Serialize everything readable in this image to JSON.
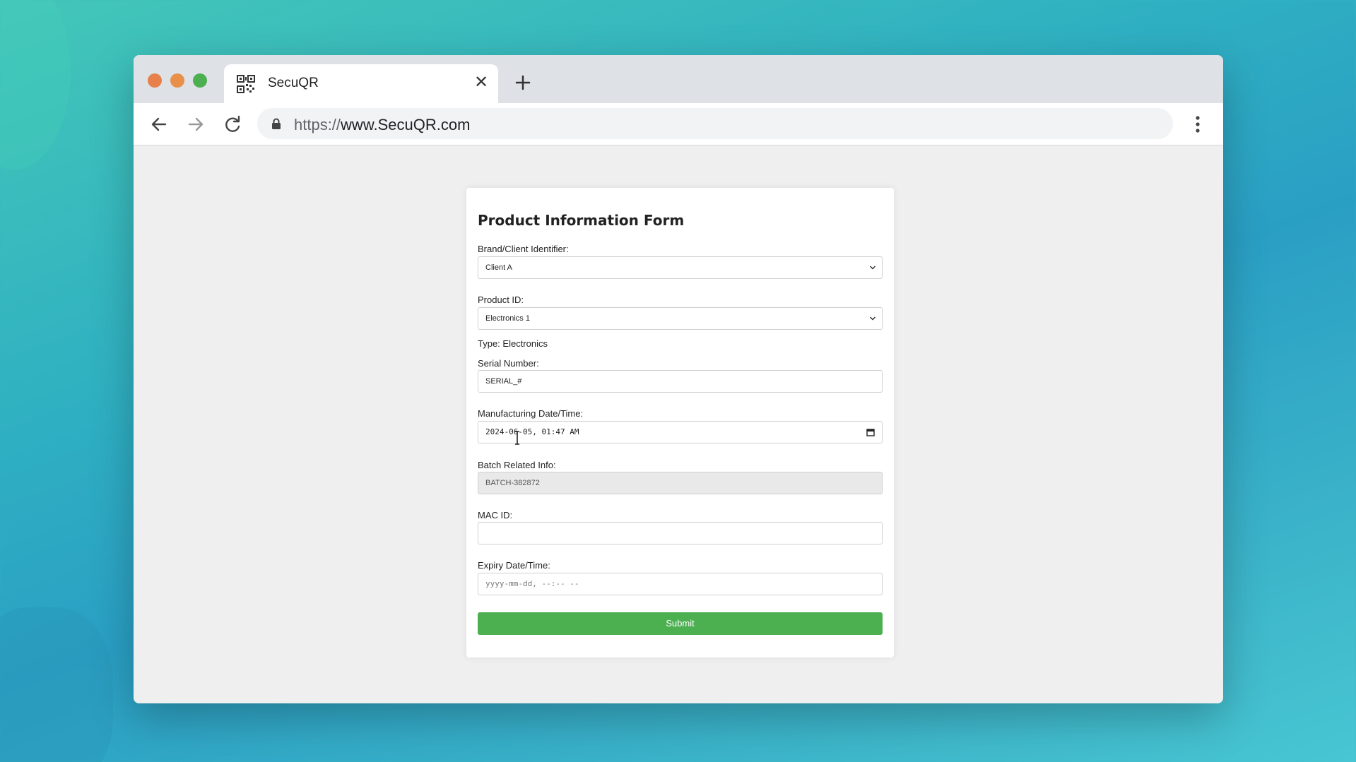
{
  "browser": {
    "tab_title": "SecuQR",
    "url_scheme": "https://",
    "url_host": "www.SecuQR.com"
  },
  "form": {
    "title": "Product Information Form",
    "brand_label": "Brand/Client Identifier:",
    "brand_value": "Client A",
    "product_label": "Product ID:",
    "product_value": "Electronics 1",
    "type_text": "Type: Electronics",
    "serial_label": "Serial Number:",
    "serial_value": "SERIAL_#",
    "mfg_label": "Manufacturing Date/Time:",
    "mfg_value": "2024-06-05, 01:47 AM",
    "batch_label": "Batch Related Info:",
    "batch_value": "BATCH-382872",
    "mac_label": "MAC ID:",
    "mac_value": "",
    "expiry_label": "Expiry Date/Time:",
    "expiry_placeholder": "yyyy-mm-dd, --:-- --",
    "submit_label": "Submit"
  },
  "colors": {
    "submit": "#4caf50",
    "traffic_red": "#e8804a",
    "traffic_yellow": "#e8904a",
    "traffic_green": "#4caf50"
  },
  "icons": [
    "qr-code-icon",
    "close-icon",
    "plus-icon",
    "back-arrow-icon",
    "forward-arrow-icon",
    "reload-icon",
    "lock-icon",
    "kebab-menu-icon",
    "chevron-down-icon",
    "calendar-icon",
    "text-cursor-icon"
  ]
}
